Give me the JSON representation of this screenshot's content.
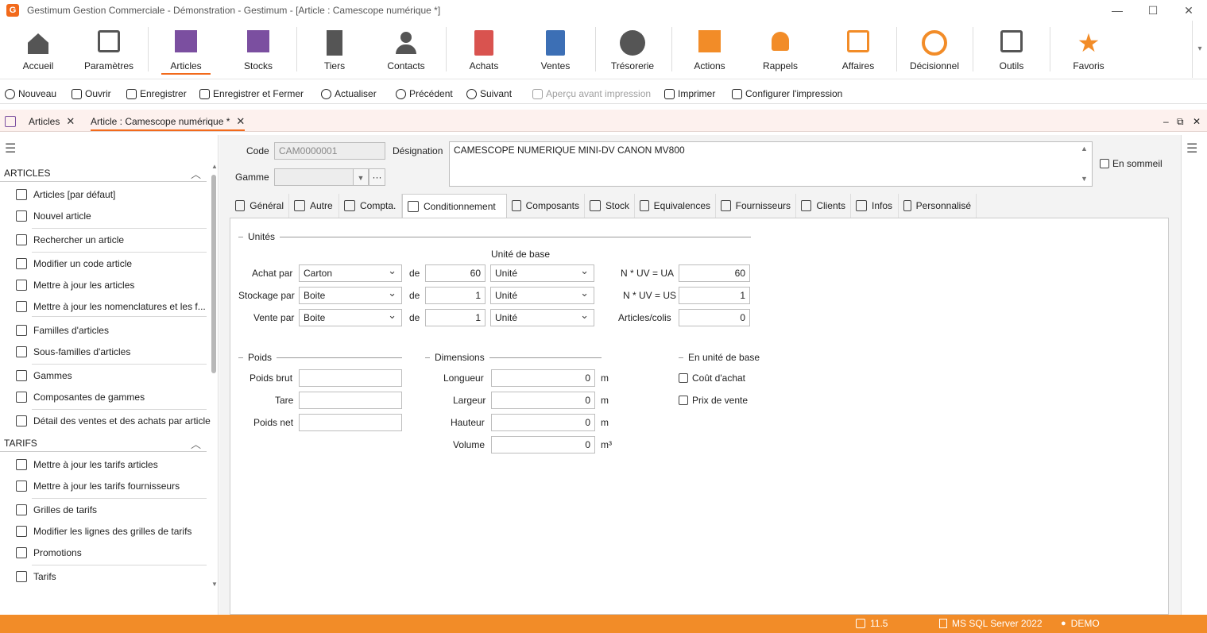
{
  "window": {
    "title": "Gestimum Gestion Commerciale - Démonstration - Gestimum - [Article : Camescope numérique *]",
    "logo_letter": "G",
    "min": "—",
    "max": "☐",
    "close": "✕"
  },
  "ribbon": [
    {
      "label": "Accueil",
      "icon": "home-icon"
    },
    {
      "label": "Paramètres",
      "icon": "sliders-icon"
    },
    {
      "label": "Articles",
      "icon": "list-icon",
      "active": true
    },
    {
      "label": "Stocks",
      "icon": "boxes-icon"
    },
    {
      "label": "Tiers",
      "icon": "building-icon"
    },
    {
      "label": "Contacts",
      "icon": "person-icon"
    },
    {
      "label": "Achats",
      "icon": "doc-a-icon"
    },
    {
      "label": "Ventes",
      "icon": "doc-v-icon"
    },
    {
      "label": "Trésorerie",
      "icon": "euro-icon"
    },
    {
      "label": "Actions",
      "icon": "check-icon"
    },
    {
      "label": "Rappels",
      "icon": "bell-icon"
    },
    {
      "label": "Affaires",
      "icon": "chart-icon"
    },
    {
      "label": "Décisionnel",
      "icon": "pie-icon"
    },
    {
      "label": "Outils",
      "icon": "tools-icon"
    },
    {
      "label": "Favoris",
      "icon": "star-icon"
    }
  ],
  "toolbar": {
    "nouveau": "Nouveau",
    "ouvrir": "Ouvrir",
    "enregistrer": "Enregistrer",
    "enregistrer_fermer": "Enregistrer et Fermer",
    "actualiser": "Actualiser",
    "precedent": "Précédent",
    "suivant": "Suivant",
    "apercu": "Aperçu avant impression",
    "imprimer": "Imprimer",
    "configurer": "Configurer l'impression"
  },
  "doctabs": {
    "tab1": "Articles",
    "tab2": "Article : Camescope numérique *",
    "close": "✕",
    "ctl_min": "‒",
    "ctl_restore": "⧉",
    "ctl_close": "✕"
  },
  "left": {
    "hamburger": "☰",
    "section_articles": "ARTICLES",
    "section_tarifs": "TARIFS",
    "chevron": "︿",
    "articles_items": [
      "Articles [par défaut]",
      "Nouvel article",
      "Rechercher un article",
      "Modifier un code article",
      "Mettre à jour les articles",
      "Mettre à jour les nomenclatures et les f...",
      "Familles d'articles",
      "Sous-familles d'articles",
      "Gammes",
      "Composantes de gammes",
      "Détail des ventes et des achats par article"
    ],
    "tarifs_items": [
      "Mettre à jour les tarifs articles",
      "Mettre à jour les tarifs fournisseurs",
      "Grilles de tarifs",
      "Modifier les lignes des grilles de tarifs",
      "Promotions",
      "Tarifs"
    ]
  },
  "header": {
    "code_label": "Code",
    "code_value": "CAM0000001",
    "gamme_label": "Gamme",
    "gamme_value": "",
    "gamme_more": "···",
    "designation_label": "Désignation",
    "designation_value": "CAMESCOPE NUMERIQUE MINI-DV CANON MV800",
    "sommeil_label": "En sommeil"
  },
  "formtabs": [
    {
      "label": "Général"
    },
    {
      "label": "Autre"
    },
    {
      "label": "Compta."
    },
    {
      "label": "Conditionnement",
      "active": true
    },
    {
      "label": "Composants"
    },
    {
      "label": "Stock"
    },
    {
      "label": "Equivalences"
    },
    {
      "label": "Fournisseurs"
    },
    {
      "label": "Clients"
    },
    {
      "label": "Infos"
    },
    {
      "label": "Personnalisé"
    }
  ],
  "unites": {
    "title": "Unités",
    "unite_base_header": "Unité de base",
    "de": "de",
    "rows": [
      {
        "label": "Achat par",
        "unit": "Carton",
        "qty": "60",
        "base": "Unité",
        "rlabel": "N * UV = UA",
        "rvalue": "60"
      },
      {
        "label": "Stockage par",
        "unit": "Boite",
        "qty": "1",
        "base": "Unité",
        "rlabel": "N * UV = US",
        "rvalue": "1"
      },
      {
        "label": "Vente par",
        "unit": "Boite",
        "qty": "1",
        "base": "Unité",
        "rlabel": "Articles/colis",
        "rvalue": "0"
      }
    ]
  },
  "poids": {
    "title": "Poids",
    "rows": [
      {
        "label": "Poids brut",
        "value": ""
      },
      {
        "label": "Tare",
        "value": ""
      },
      {
        "label": "Poids net",
        "value": ""
      }
    ]
  },
  "dimensions": {
    "title": "Dimensions",
    "rows": [
      {
        "label": "Longueur",
        "value": "0",
        "unit": "m"
      },
      {
        "label": "Largeur",
        "value": "0",
        "unit": "m"
      },
      {
        "label": "Hauteur",
        "value": "0",
        "unit": "m"
      },
      {
        "label": "Volume",
        "value": "0",
        "unit": "m³"
      }
    ]
  },
  "unite_base": {
    "title": "En unité de base",
    "cout": "Coût d'achat",
    "prix": "Prix de vente"
  },
  "status": {
    "version": "11.5",
    "db": "MS SQL Server 2022",
    "user": "DEMO"
  },
  "colors": {
    "accent": "#f26a1b",
    "purple": "#7b4fa0",
    "status_bar": "#f28c28"
  }
}
